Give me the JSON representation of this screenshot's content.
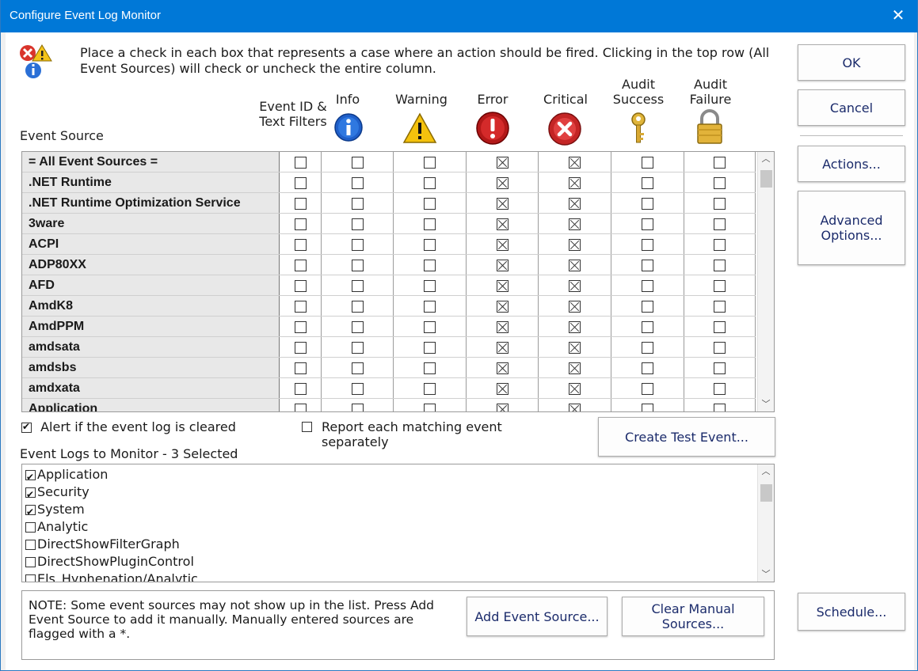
{
  "window": {
    "title": "Configure Event Log Monitor",
    "close": "✕"
  },
  "instructions": "Place a check in each box that represents a case where an action should be fired. Clicking in the top row (All Event Sources) will check or uncheck the entire column.",
  "buttons": {
    "ok": "OK",
    "cancel": "Cancel",
    "actions": "Actions...",
    "advanced": "Advanced Options...",
    "create_test": "Create Test Event...",
    "add_source": "Add Event Source...",
    "clear_manual": "Clear Manual Sources...",
    "schedule": "Schedule..."
  },
  "columns": {
    "source": "Event Source",
    "filters": "Event ID & Text Filters",
    "info": "Info",
    "warning": "Warning",
    "error": "Error",
    "critical": "Critical",
    "audit_success": "Audit Success",
    "audit_failure": "Audit Failure"
  },
  "rows": [
    {
      "name": "= All Event Sources =",
      "checks": [
        false,
        false,
        false,
        true,
        true,
        false,
        false
      ]
    },
    {
      "name": ".NET Runtime",
      "checks": [
        false,
        false,
        false,
        true,
        true,
        false,
        false
      ]
    },
    {
      "name": ".NET Runtime Optimization Service",
      "checks": [
        false,
        false,
        false,
        true,
        true,
        false,
        false
      ]
    },
    {
      "name": "3ware",
      "checks": [
        false,
        false,
        false,
        true,
        true,
        false,
        false
      ]
    },
    {
      "name": "ACPI",
      "checks": [
        false,
        false,
        false,
        true,
        true,
        false,
        false
      ]
    },
    {
      "name": "ADP80XX",
      "checks": [
        false,
        false,
        false,
        true,
        true,
        false,
        false
      ]
    },
    {
      "name": "AFD",
      "checks": [
        false,
        false,
        false,
        true,
        true,
        false,
        false
      ]
    },
    {
      "name": "AmdK8",
      "checks": [
        false,
        false,
        false,
        true,
        true,
        false,
        false
      ]
    },
    {
      "name": "AmdPPM",
      "checks": [
        false,
        false,
        false,
        true,
        true,
        false,
        false
      ]
    },
    {
      "name": "amdsata",
      "checks": [
        false,
        false,
        false,
        true,
        true,
        false,
        false
      ]
    },
    {
      "name": "amdsbs",
      "checks": [
        false,
        false,
        false,
        true,
        true,
        false,
        false
      ]
    },
    {
      "name": "amdxata",
      "checks": [
        false,
        false,
        false,
        true,
        true,
        false,
        false
      ]
    },
    {
      "name": "Application",
      "checks": [
        false,
        false,
        false,
        true,
        true,
        false,
        false
      ]
    }
  ],
  "options": {
    "alert_cleared": {
      "label": "Alert if the event log is cleared",
      "checked": true
    },
    "report_separately": {
      "label": "Report each matching event separately",
      "checked": false
    }
  },
  "logs": {
    "heading": "Event Logs to Monitor - 3 Selected",
    "items": [
      {
        "label": "Application",
        "checked": true
      },
      {
        "label": "Security",
        "checked": true
      },
      {
        "label": "System",
        "checked": true
      },
      {
        "label": "Analytic",
        "checked": false
      },
      {
        "label": "DirectShowFilterGraph",
        "checked": false
      },
      {
        "label": "DirectShowPluginControl",
        "checked": false
      },
      {
        "label": "Els_Hyphenation/Analytic",
        "checked": false
      }
    ]
  },
  "note": "NOTE: Some event sources may not show up in the list.  Press Add Event Source to add it manually.  Manually entered sources are flagged with a *.",
  "icons": {
    "header": "warning-error-info-icon",
    "info": "info-icon",
    "warning": "warning-icon",
    "error": "error-icon",
    "critical": "critical-icon",
    "audit_success": "key-icon",
    "audit_failure": "lock-icon"
  }
}
